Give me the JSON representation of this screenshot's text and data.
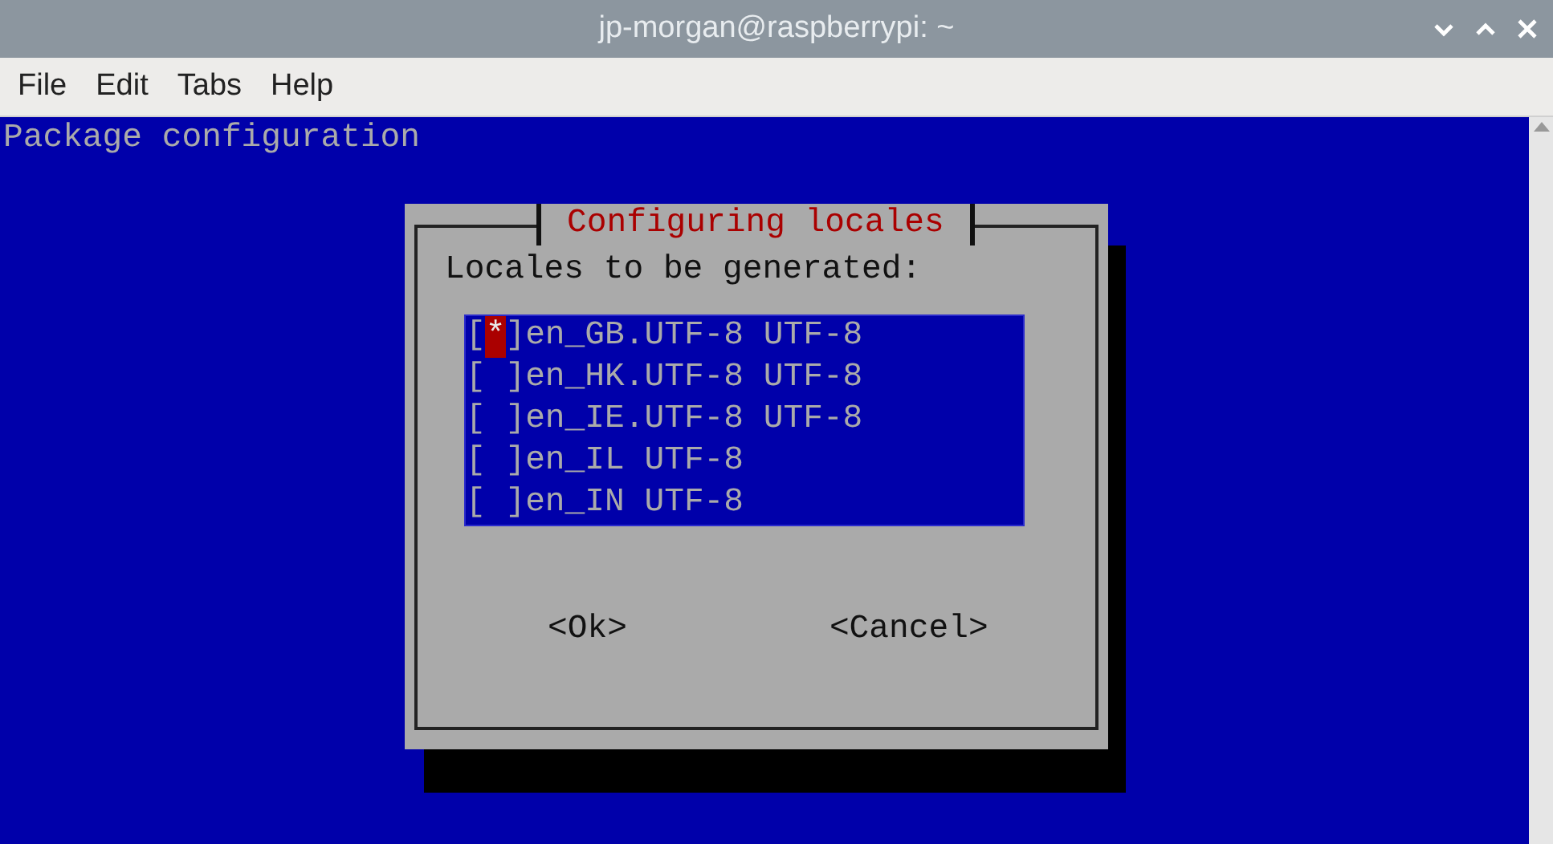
{
  "window": {
    "title": "jp-morgan@raspberrypi: ~"
  },
  "menu": [
    "File",
    "Edit",
    "Tabs",
    "Help"
  ],
  "terminal": {
    "header": "Package configuration"
  },
  "dialog": {
    "title": "Configuring locales",
    "prompt": "Locales to be generated:",
    "list": {
      "bracket_left": "[",
      "bracket_right": "]",
      "mark_symbol": "*",
      "items": [
        {
          "label": "en_GB.UTF-8 UTF-8",
          "checked": true,
          "cursor": true
        },
        {
          "label": "en_HK.UTF-8 UTF-8",
          "checked": false,
          "cursor": false
        },
        {
          "label": "en_IE.UTF-8 UTF-8",
          "checked": false,
          "cursor": false
        },
        {
          "label": "en_IL UTF-8",
          "checked": false,
          "cursor": false
        },
        {
          "label": "en_IN UTF-8",
          "checked": false,
          "cursor": false
        }
      ]
    },
    "buttons": [
      "<Ok>",
      "<Cancel>"
    ]
  }
}
